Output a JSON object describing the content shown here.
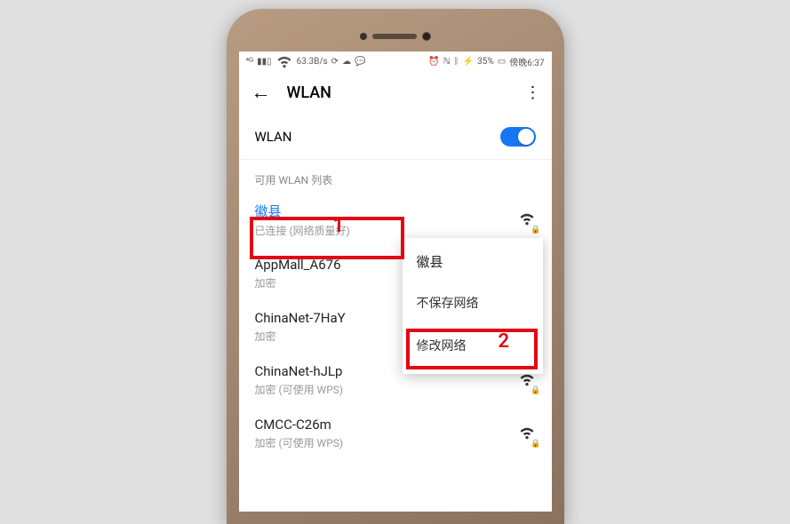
{
  "statusbar": {
    "net_label": "63.3B/s",
    "battery": "35%",
    "time": "傍晚6:37"
  },
  "header": {
    "title": "WLAN"
  },
  "toggle": {
    "label": "WLAN"
  },
  "section": {
    "label": "可用 WLAN 列表"
  },
  "networks": [
    {
      "name": "徽县",
      "sub": "已连接 (网络质量好)",
      "connected": true,
      "locked": true
    },
    {
      "name": "AppMall_A676",
      "sub": "加密",
      "connected": false,
      "locked": true
    },
    {
      "name": "ChinaNet-7HaY",
      "sub": "加密",
      "connected": false,
      "locked": true
    },
    {
      "name": "ChinaNet-hJLp",
      "sub": "加密 (可使用 WPS)",
      "connected": false,
      "locked": true
    },
    {
      "name": "CMCC-C26m",
      "sub": "加密 (可使用 WPS)",
      "connected": false,
      "locked": true
    }
  ],
  "popup": {
    "title": "徽县",
    "forget": "不保存网络",
    "modify": "修改网络"
  },
  "annotations": {
    "num1": "1",
    "num2": "2"
  }
}
